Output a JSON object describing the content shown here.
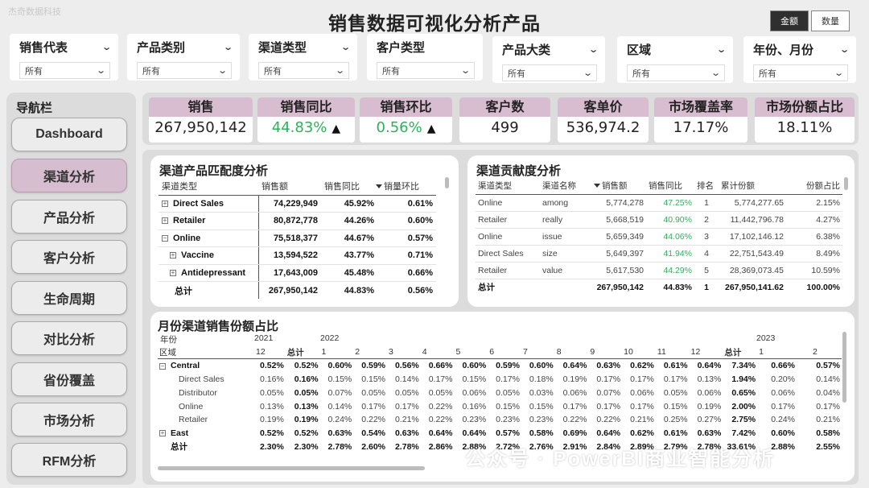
{
  "top_mark": "杰奇数据科技",
  "title": "销售数据可视化分析产品",
  "toggle": {
    "amount": "金额",
    "quantity": "数量"
  },
  "filters": [
    {
      "label": "销售代表",
      "value": "所有"
    },
    {
      "label": "产品类别",
      "value": "所有"
    },
    {
      "label": "渠道类型",
      "value": "所有"
    },
    {
      "label": "客户类型",
      "value": "所有"
    },
    {
      "label": "产品大类",
      "value": "所有"
    },
    {
      "label": "区域",
      "value": "所有"
    },
    {
      "label": "年份、月份",
      "value": "所有"
    }
  ],
  "nav": {
    "title": "导航栏",
    "items": [
      "Dashboard",
      "渠道分析",
      "产品分析",
      "客户分析",
      "生命周期",
      "对比分析",
      "省份覆盖",
      "市场分析",
      "RFM分析"
    ],
    "active": "渠道分析"
  },
  "kpis": [
    {
      "label": "销售",
      "value": "267,950,142"
    },
    {
      "label": "销售同比",
      "value": "44.83%",
      "arrow": "▲"
    },
    {
      "label": "销售环比",
      "value": "0.56%",
      "arrow": "▲"
    },
    {
      "label": "客户数",
      "value": "499"
    },
    {
      "label": "客单价",
      "value": "536,974.2"
    },
    {
      "label": "市场覆盖率",
      "value": "17.17%"
    },
    {
      "label": "市场份额占比",
      "value": "18.11%"
    }
  ],
  "match": {
    "title": "渠道产品匹配度分析",
    "headers": [
      "渠道类型",
      "销售额",
      "销售同比",
      "销量环比"
    ],
    "rows": [
      {
        "name": "Direct Sales",
        "sales": "74,229,949",
        "yoy": "45.92%",
        "mom": "0.61%",
        "icon": "⊞"
      },
      {
        "name": "Retailer",
        "sales": "80,872,778",
        "yoy": "44.26%",
        "mom": "0.60%",
        "icon": "⊞"
      },
      {
        "name": "Online",
        "sales": "75,518,377",
        "yoy": "44.67%",
        "mom": "0.57%",
        "icon": "⊟"
      },
      {
        "name": "Vaccine",
        "sales": "13,594,522",
        "yoy": "43.77%",
        "mom": "0.71%",
        "icon": "⊞"
      },
      {
        "name": "Antidepressant",
        "sales": "17,643,009",
        "yoy": "45.48%",
        "mom": "0.66%",
        "icon": "⊞"
      }
    ],
    "total": {
      "name": "总计",
      "sales": "267,950,142",
      "yoy": "44.83%",
      "mom": "0.56%"
    }
  },
  "contrib": {
    "title": "渠道贡献度分析",
    "headers": [
      "渠道类型",
      "渠道名称",
      "销售额",
      "销售同比",
      "排名",
      "累计份额",
      "份额占比"
    ],
    "rows": [
      {
        "type": "Online",
        "name": "among",
        "sales": "5,774,278",
        "yoy": "47.25%",
        "rank": "1",
        "cum": "5,774,277.65",
        "share": "2.15%"
      },
      {
        "type": "Retailer",
        "name": "really",
        "sales": "5,668,519",
        "yoy": "40.90%",
        "rank": "2",
        "cum": "11,442,796.78",
        "share": "4.27%"
      },
      {
        "type": "Online",
        "name": "issue",
        "sales": "5,659,349",
        "yoy": "44.06%",
        "rank": "3",
        "cum": "17,102,146.12",
        "share": "6.38%"
      },
      {
        "type": "Direct Sales",
        "name": "size",
        "sales": "5,649,397",
        "yoy": "41.94%",
        "rank": "4",
        "cum": "22,751,543.49",
        "share": "8.49%"
      },
      {
        "type": "Retailer",
        "name": "value",
        "sales": "5,617,530",
        "yoy": "44.29%",
        "rank": "5",
        "cum": "28,369,073.45",
        "share": "10.59%"
      }
    ],
    "total": {
      "type": "总计",
      "sales": "267,950,142",
      "yoy": "44.83%",
      "rank": "1",
      "cum": "267,950,141.62",
      "share": "100.00%"
    }
  },
  "monthly": {
    "title": "月份渠道销售份额占比",
    "year_label": "年份",
    "region_label": "区域",
    "years": [
      "2021",
      "2022",
      "2023"
    ],
    "cols": [
      "12",
      "总计",
      "1",
      "2",
      "3",
      "4",
      "5",
      "6",
      "7",
      "8",
      "9",
      "10",
      "11",
      "12",
      "总计",
      "1",
      "2"
    ],
    "rows": [
      {
        "kind": "grp",
        "icon": "⊟",
        "name": "Central",
        "v": [
          "0.52%",
          "0.52%",
          "0.60%",
          "0.59%",
          "0.56%",
          "0.66%",
          "0.60%",
          "0.59%",
          "0.60%",
          "0.64%",
          "0.63%",
          "0.62%",
          "0.61%",
          "0.64%",
          "7.34%",
          "0.66%",
          "0.57%"
        ]
      },
      {
        "kind": "sub",
        "name": "Direct Sales",
        "v": [
          "0.16%",
          "0.16%",
          "0.15%",
          "0.15%",
          "0.14%",
          "0.17%",
          "0.15%",
          "0.17%",
          "0.18%",
          "0.19%",
          "0.17%",
          "0.17%",
          "0.17%",
          "0.13%",
          "1.94%",
          "0.20%",
          "0.14%"
        ]
      },
      {
        "kind": "sub",
        "name": "Distributor",
        "v": [
          "0.05%",
          "0.05%",
          "0.07%",
          "0.05%",
          "0.05%",
          "0.05%",
          "0.06%",
          "0.05%",
          "0.03%",
          "0.06%",
          "0.07%",
          "0.06%",
          "0.05%",
          "0.06%",
          "0.65%",
          "0.06%",
          "0.04%"
        ]
      },
      {
        "kind": "sub",
        "name": "Online",
        "v": [
          "0.13%",
          "0.13%",
          "0.14%",
          "0.17%",
          "0.17%",
          "0.22%",
          "0.16%",
          "0.15%",
          "0.15%",
          "0.17%",
          "0.17%",
          "0.17%",
          "0.15%",
          "0.19%",
          "2.00%",
          "0.17%",
          "0.17%"
        ]
      },
      {
        "kind": "sub",
        "name": "Retailer",
        "v": [
          "0.19%",
          "0.19%",
          "0.24%",
          "0.22%",
          "0.21%",
          "0.22%",
          "0.23%",
          "0.23%",
          "0.23%",
          "0.22%",
          "0.22%",
          "0.21%",
          "0.25%",
          "0.27%",
          "2.75%",
          "0.24%",
          "0.21%"
        ]
      },
      {
        "kind": "grp",
        "icon": "⊞",
        "name": "East",
        "v": [
          "0.52%",
          "0.52%",
          "0.63%",
          "0.54%",
          "0.63%",
          "0.64%",
          "0.64%",
          "0.57%",
          "0.58%",
          "0.69%",
          "0.64%",
          "0.62%",
          "0.61%",
          "0.63%",
          "7.42%",
          "0.60%",
          "0.58%"
        ]
      }
    ],
    "total": {
      "name": "总计",
      "v": [
        "2.30%",
        "2.30%",
        "2.78%",
        "2.60%",
        "2.78%",
        "2.86%",
        "2.88%",
        "2.72%",
        "2.76%",
        "2.91%",
        "2.84%",
        "2.89%",
        "2.79%",
        "2.78%",
        "33.61%",
        "2.88%",
        "2.55%"
      ]
    }
  },
  "watermark": "公众号 · PowerBI商业智能分析"
}
